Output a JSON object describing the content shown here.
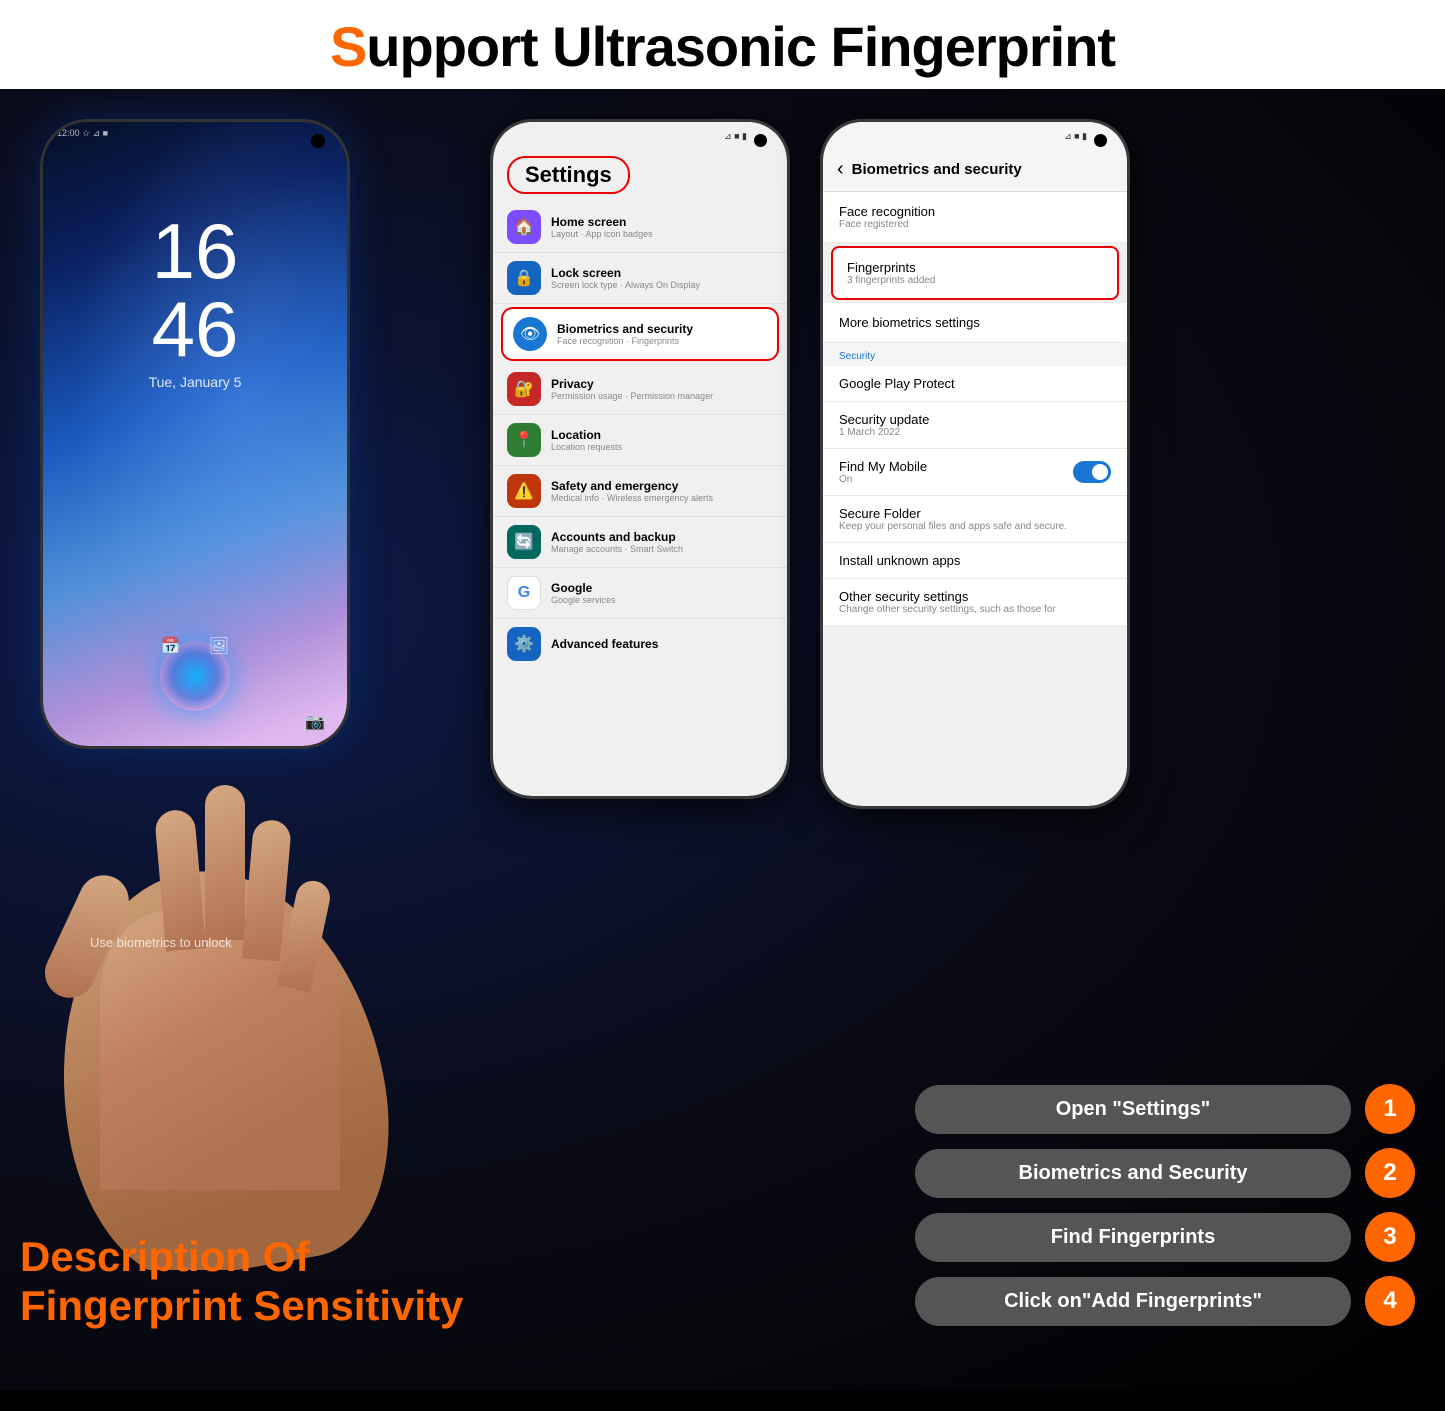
{
  "header": {
    "title": "Support Ultrasonic Fingerprint",
    "s_letter": "S"
  },
  "left_phone": {
    "time": "16",
    "minute": "46",
    "date": "Tue, January 5",
    "unlock_text": "Use biometrics to unlock"
  },
  "middle_phone": {
    "header": "Settings",
    "items": [
      {
        "icon": "🏠",
        "icon_class": "icon-purple",
        "title": "Home screen",
        "subtitle": "Layout · App icon badges"
      },
      {
        "icon": "🔒",
        "icon_class": "icon-blue",
        "title": "Lock screen",
        "subtitle": "Screen lock type · Always On Display"
      },
      {
        "icon": "👁",
        "icon_class": "icon-blue2",
        "title": "Biometrics and security",
        "subtitle": "Face recognition · Fingerprints",
        "highlighted": true
      },
      {
        "icon": "🔒",
        "icon_class": "icon-red",
        "title": "Privacy",
        "subtitle": "Permission usage · Permission manager"
      },
      {
        "icon": "📍",
        "icon_class": "icon-green",
        "title": "Location",
        "subtitle": "Location requests"
      },
      {
        "icon": "⚠",
        "icon_class": "icon-red",
        "title": "Safety and emergency",
        "subtitle": "Medical info · Wireless emergency alerts"
      },
      {
        "icon": "🔄",
        "icon_class": "icon-teal",
        "title": "Accounts and backup",
        "subtitle": "Manage accounts · Smart Switch"
      },
      {
        "icon": "G",
        "icon_class": "icon-google",
        "title": "Google",
        "subtitle": "Google services"
      },
      {
        "icon": "⚙",
        "icon_class": "icon-blue2",
        "title": "Advanced features",
        "subtitle": ""
      }
    ]
  },
  "right_phone": {
    "back_label": "‹",
    "title": "Biometrics and security",
    "items": [
      {
        "title": "Face recognition",
        "subtitle": "Face registered",
        "highlighted": false
      },
      {
        "title": "Fingerprints",
        "subtitle": "3 fingerprints added",
        "highlighted": true
      },
      {
        "title": "More biometrics settings",
        "subtitle": ""
      },
      {
        "section": "Security"
      },
      {
        "title": "Google Play Protect",
        "subtitle": ""
      },
      {
        "title": "Security update",
        "subtitle": "1 March 2022"
      },
      {
        "title": "Find My Mobile",
        "subtitle": "On",
        "toggle": true
      },
      {
        "title": "Secure Folder",
        "subtitle": "Keep your personal files and apps safe and secure."
      },
      {
        "title": "Install unknown apps",
        "subtitle": ""
      },
      {
        "title": "Other security settings",
        "subtitle": "Change other security settings, such as those for"
      }
    ]
  },
  "steps": [
    {
      "label": "Open \"Settings\"",
      "number": "1"
    },
    {
      "label": "Biometrics and Security",
      "number": "2"
    },
    {
      "label": "Find Fingerprints",
      "number": "3"
    },
    {
      "label": "Click on\"Add Fingerprints\"",
      "number": "4"
    }
  ],
  "description": {
    "line1": "Description Of",
    "line2": "Fingerprint Sensitivity"
  },
  "colors": {
    "orange": "#ff6600",
    "dark_bg": "#1a1a2e",
    "highlight_red": "#e00000"
  }
}
